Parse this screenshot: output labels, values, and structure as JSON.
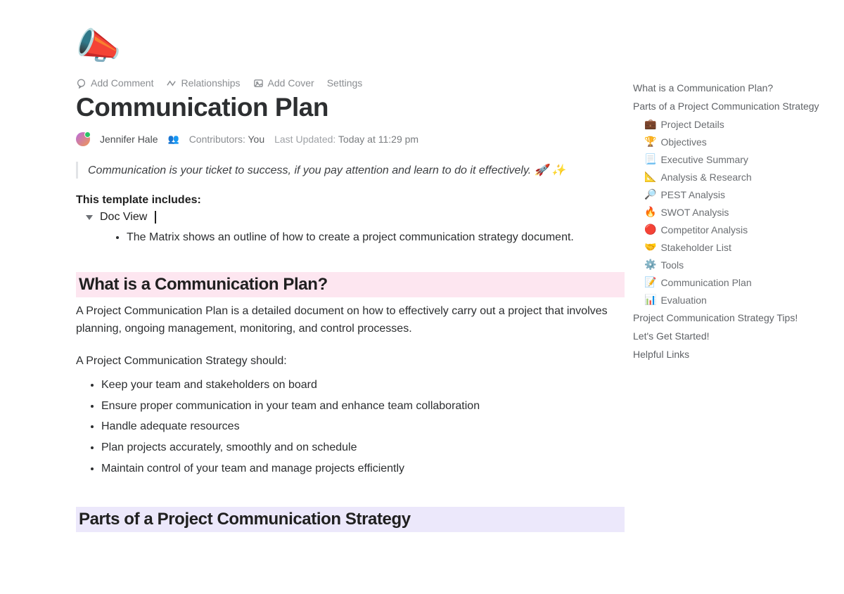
{
  "icon": "📣",
  "toolbar": {
    "comment": "Add Comment",
    "relationships": "Relationships",
    "cover": "Add Cover",
    "settings": "Settings"
  },
  "title": "Communication Plan",
  "meta": {
    "author": "Jennifer Hale",
    "contributors_label": "Contributors:",
    "contributors_value": "You",
    "updated_label": "Last Updated:",
    "updated_value": "Today at 11:29 pm"
  },
  "quote": "Communication is your ticket to success, if you pay attention and learn to do it effectively. 🚀 ✨",
  "template_includes_label": "This template includes:",
  "doc_view_label": "Doc View",
  "doc_view_sub": "The Matrix shows an outline of how to create a project communication strategy document.",
  "section1": {
    "heading": "What is a Communication Plan?",
    "p1": "A Project Communication Plan is a detailed document on how to effectively carry out a project that involves planning, ongoing management, monitoring, and control processes.",
    "p2": "A Project Communication Strategy should:",
    "bullets": [
      "Keep your team and stakeholders on board",
      "Ensure proper communication in your team and enhance team collaboration",
      "Handle adequate resources",
      "Plan projects accurately, smoothly and on schedule",
      "Maintain control of your team and manage projects efficiently"
    ]
  },
  "section2": {
    "heading": "Parts of a Project Communication Strategy"
  },
  "outline": {
    "top": [
      "What is a Communication Plan?",
      "Parts of a Project Communication Strategy"
    ],
    "subs": [
      {
        "icon": "💼",
        "label": "Project Details"
      },
      {
        "icon": "🏆",
        "label": "Objectives"
      },
      {
        "icon": "📃",
        "label": "Executive Summary"
      },
      {
        "icon": "📐",
        "label": "Analysis & Research"
      },
      {
        "icon": "🔎",
        "label": "PEST Analysis"
      },
      {
        "icon": "🔥",
        "label": "SWOT Analysis"
      },
      {
        "icon": "🔴",
        "label": "Competitor Analysis"
      },
      {
        "icon": "🤝",
        "label": "Stakeholder List"
      },
      {
        "icon": "⚙️",
        "label": "Tools"
      },
      {
        "icon": "📝",
        "label": "Communication Plan"
      },
      {
        "icon": "📊",
        "label": "Evaluation"
      }
    ],
    "bottom": [
      "Project Communication Strategy Tips!",
      "Let's Get Started!",
      "Helpful Links"
    ]
  }
}
